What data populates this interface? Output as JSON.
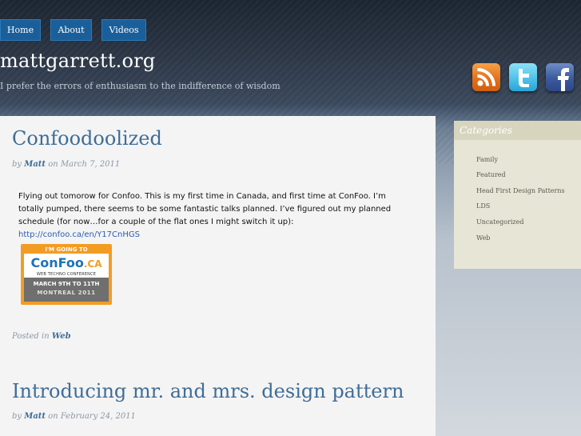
{
  "nav": {
    "items": [
      {
        "label": "Home"
      },
      {
        "label": "About"
      },
      {
        "label": "Videos"
      }
    ]
  },
  "site": {
    "title": "mattgarrett.org",
    "tagline": "I prefer the errors of enthusiasm to the indifference of wisdom"
  },
  "social": {
    "icons": [
      "rss-icon",
      "twitter-icon",
      "facebook-icon"
    ],
    "colors": {
      "rss": "#e3711c",
      "twitter": "#4fc2ea",
      "facebook": "#3b5a9c"
    }
  },
  "posts": [
    {
      "title": "Confoodoolized",
      "by": "by",
      "author": "Matt",
      "on": "on",
      "date": "March 7, 2011",
      "body": "Flying out tomorow for Confoo.  This is my first time in Canada, and first time at ConFoo.  I’m totally pumped, there seems to be some fantastic talks planned.  I’ve figured out my planned schedule (for now…for a couple of the flat ones I might switch it up): ",
      "link_text": "http://confoo.ca/en/Y17CnHGS",
      "badge": {
        "top": "I'M GOING TO",
        "logo": "ConFoo",
        "logo_suffix": ".CA",
        "sub": "WEB TECHNO CONFERENCE",
        "dates": "MARCH 9TH TO 11TH",
        "city": "MONTREAL 2011"
      },
      "posted_in_label": "Posted in",
      "category": "Web"
    },
    {
      "title": "Introducing mr. and mrs. design pattern",
      "by": "by",
      "author": "Matt",
      "on": "on",
      "date": "February 24, 2011"
    }
  ],
  "sidebar": {
    "heading": "Categories",
    "items": [
      "Family",
      "Featured",
      "Head First Design Patterns",
      "LDS",
      "Uncategorized",
      "Web"
    ]
  },
  "colors": {
    "nav_bg": "#1a5f9a",
    "title_link": "#3f6d97",
    "sidebar_bg": "#e7e5d5"
  }
}
